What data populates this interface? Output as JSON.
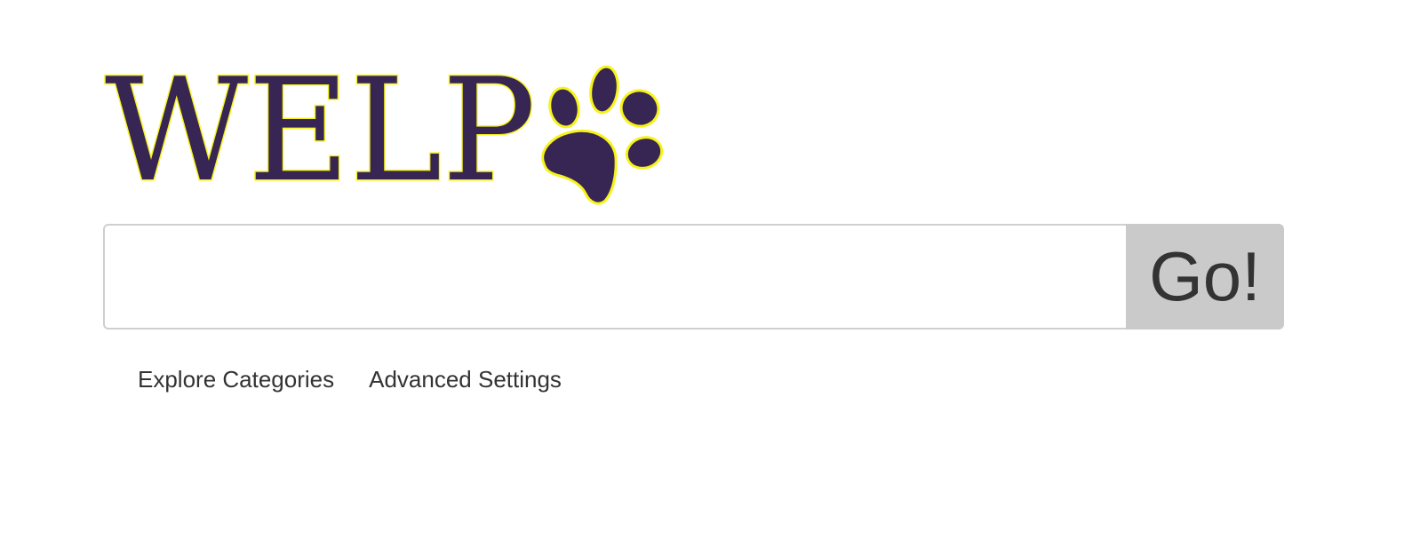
{
  "logo": {
    "text": "WELP",
    "fill_color": "#372553",
    "outline_color": "#f7f31a",
    "icon": "paw-print-icon"
  },
  "search": {
    "value": "",
    "placeholder": "",
    "button_label": "Go!"
  },
  "links": {
    "explore": "Explore Categories",
    "advanced": "Advanced Settings"
  },
  "colors": {
    "button_bg": "#cacaca",
    "text": "#333333",
    "input_border": "#cfcfcf"
  }
}
